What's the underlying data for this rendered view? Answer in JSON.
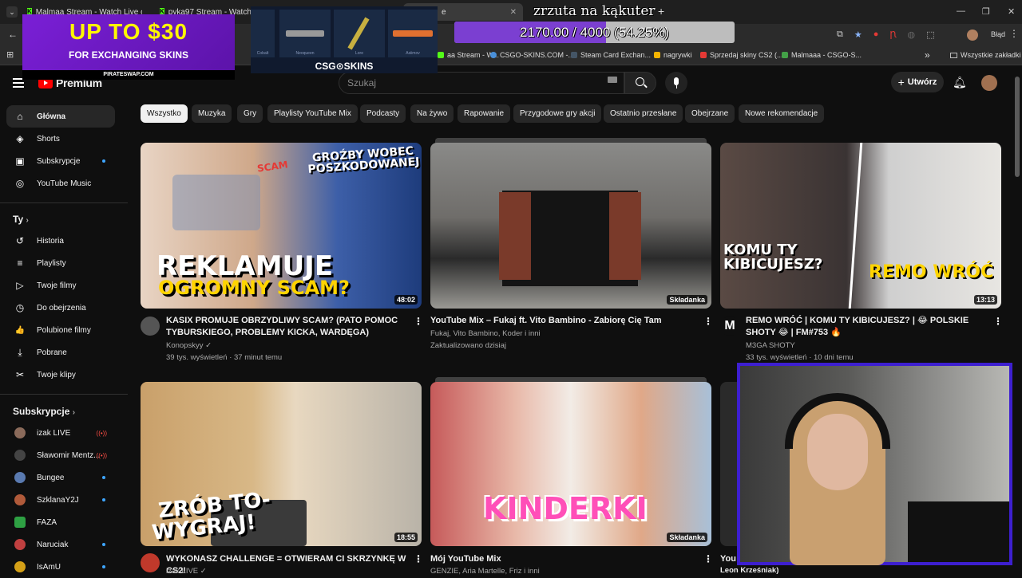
{
  "browser": {
    "tabs": [
      {
        "label": "Malmaa Stream - Watch Live o",
        "favicon": "K"
      },
      {
        "label": "pyka97 Stream - Watch Live o",
        "favicon": "K"
      },
      {
        "label": "e"
      }
    ],
    "new_tab_label": "+",
    "bookmarks": [
      {
        "label": "aa Stream - W...",
        "color": "#53fc18"
      },
      {
        "label": "CSGO-SKINS.COM -...",
        "color": "#4a90d9"
      },
      {
        "label": "Steam Card Exchan...",
        "color": "#1b2838"
      },
      {
        "label": "nagrywki",
        "color": "#f4b400"
      },
      {
        "label": "Sprzedaj skiny CS2 (...",
        "color": "#e53935"
      },
      {
        "label": "Malmaaa - CSGO-S...",
        "color": "#43a047"
      },
      {
        "label": "Wszystkie zakładki",
        "color": "#888888"
      }
    ],
    "profile_status": "Błąd",
    "bookmark_overflow": "»"
  },
  "overlays": {
    "promo_headline": "UP TO $30",
    "promo_sub": "FOR EXCHANGING SKINS",
    "promo_site": "PIRATESWAP.COM",
    "csgo_brand": "CSG⊙SKINS",
    "csgo_items": [
      "Cobalt",
      "Neoqueen",
      "Lore",
      "Asiimov"
    ],
    "goal_title": "zrzuta na kąkuter",
    "goal_current": 2170.0,
    "goal_target": 4000,
    "goal_text": "2170.00 / 4000 (54.25%)",
    "goal_fill_color": "#7b3fd1",
    "cam_border_color": "#3d1fd0"
  },
  "youtube": {
    "logo_label": "Premium",
    "search_placeholder": "Szukaj",
    "create_label": "Utwórz",
    "sidebar": {
      "main": [
        {
          "label": "Główna",
          "icon": "home-icon",
          "glyph": "⌂",
          "active": true
        },
        {
          "label": "Shorts",
          "icon": "shorts-icon",
          "glyph": "◈"
        },
        {
          "label": "Subskrypcje",
          "icon": "subscriptions-icon",
          "glyph": "▣",
          "dot": true
        },
        {
          "label": "YouTube Music",
          "icon": "music-icon",
          "glyph": "◎"
        }
      ],
      "you_header": "Ty",
      "you": [
        {
          "label": "Historia",
          "icon": "history-icon",
          "glyph": "↺"
        },
        {
          "label": "Playlisty",
          "icon": "playlists-icon",
          "glyph": "≡"
        },
        {
          "label": "Twoje filmy",
          "icon": "your-videos-icon",
          "glyph": "▷"
        },
        {
          "label": "Do obejrzenia",
          "icon": "watch-later-icon",
          "glyph": "◷"
        },
        {
          "label": "Polubione filmy",
          "icon": "liked-icon",
          "glyph": "👍"
        },
        {
          "label": "Pobrane",
          "icon": "downloads-icon",
          "glyph": "⤓"
        },
        {
          "label": "Twoje klipy",
          "icon": "clips-icon",
          "glyph": "✂"
        }
      ],
      "subs_header": "Subskrypcje",
      "subscriptions": [
        {
          "label": "izak LIVE",
          "color": "#8a6a5a",
          "status": "live"
        },
        {
          "label": "Sławomir Mentz...",
          "color": "#444444",
          "status": "live"
        },
        {
          "label": "Bungee",
          "color": "#5a7ab0",
          "status": "dot"
        },
        {
          "label": "SzklanaY2J",
          "color": "#b05a3a",
          "status": "dot"
        },
        {
          "label": "FAZA",
          "color": "#2ea043",
          "status": "none"
        },
        {
          "label": "Naruciak",
          "color": "#c04040",
          "status": "dot"
        },
        {
          "label": "IsAmU",
          "color": "#d4a017",
          "status": "dot"
        }
      ]
    },
    "chips": [
      "Wszystko",
      "Muzyka",
      "Gry",
      "Playlisty YouTube Mix",
      "Podcasty",
      "Na żywo",
      "Rapowanie",
      "Przygodowe gry akcji",
      "Ostatnio przesłane",
      "Obejrzane",
      "Nowe rekomendacje"
    ],
    "videos": [
      {
        "title": "KASIX PROMUJE OBRZYDLIWY SCAM? (PATO POMOC TYBURSKIEGO, PROBLEMY KICKA, WARDĘGA)",
        "channel": "Konopskyy",
        "verified": "✓",
        "meta": "39 tys. wyświetleń · 37 minut temu",
        "duration": "48:02",
        "thumb_top": "GROŹBY WOBEC POSZKODOWANEJ",
        "thumb_main1": "REKLAMUJE",
        "thumb_main2": "OGROMNY SCAM?",
        "thumb_badge": "SCAM",
        "avatar_color": "#555555"
      },
      {
        "title": "YouTube Mix – Fukaj ft. Vito Bambino - Zabiorę Cię Tam",
        "channel": "Fukaj, Vito Bambino, Koder i inni",
        "meta": "Zaktualizowano dzisiaj",
        "duration": "Składanka"
      },
      {
        "title": "REMO WRÓĆ | KOMU TY KIBICUJESZ? | 😂 POLSKIE SHOTY 😂 | FM#753 🔥",
        "channel": "M3GA SHOTY",
        "meta": "33 tys. wyświetleń · 10 dni temu",
        "duration": "13:13",
        "thumb_left": "KOMU TY KIBICUJESZ?",
        "thumb_right": "REMO WRÓĆ",
        "avatar_letter": "M"
      },
      {
        "title": "WYKONASZ CHALLENGE = OTWIERAM CI SKRZYNKĘ W CS2!",
        "channel": "izak LIVE",
        "duration": "18:55",
        "thumb_main1": "ZRÓB TO-",
        "thumb_main2": "WYGRAJ!",
        "avatar_color": "#c0392b"
      },
      {
        "title": "Mój YouTube Mix",
        "channel": "GENZIE, Aria Martelle, Friz i inni",
        "duration": "Składanka",
        "thumb_main1": "KINDERKI"
      },
      {
        "title": "You",
        "channel": "Leon Krześniak)"
      }
    ]
  }
}
